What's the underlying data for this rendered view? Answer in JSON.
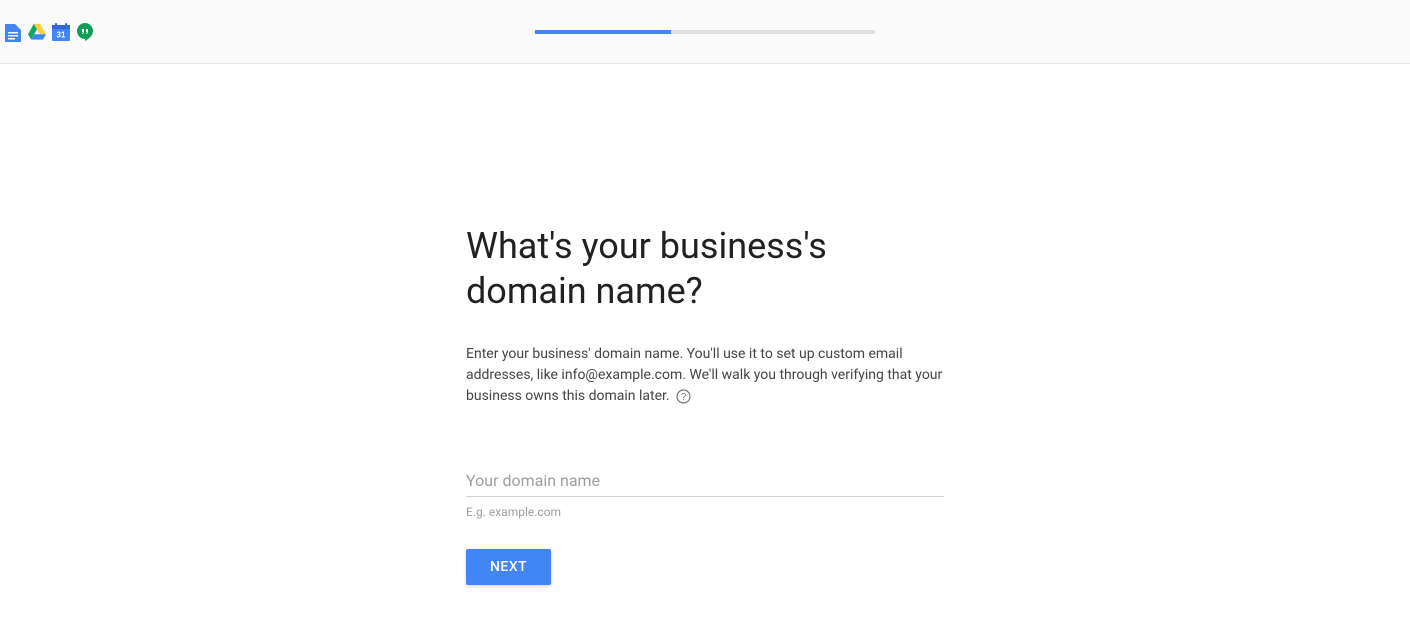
{
  "header": {
    "icons": [
      {
        "name": "docs-icon"
      },
      {
        "name": "drive-icon"
      },
      {
        "name": "calendar-icon",
        "day": "31"
      },
      {
        "name": "hangouts-icon"
      }
    ],
    "progress_percent": 40
  },
  "main": {
    "title": "What's your business's domain name?",
    "description": "Enter your business' domain name. You'll use it to set up custom email addresses, like info@example.com. We'll walk you through verifying that your business owns this domain later.",
    "domain_input": {
      "placeholder": "Your domain name",
      "value": "",
      "hint": "E.g. example.com"
    },
    "next_button_label": "NEXT"
  }
}
